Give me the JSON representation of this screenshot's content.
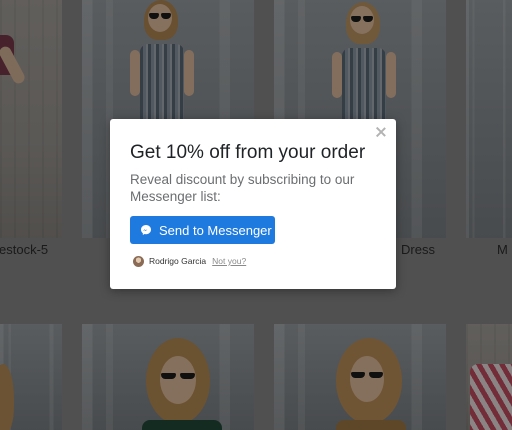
{
  "products": {
    "captions": [
      "estock-5",
      "Dress",
      "M"
    ]
  },
  "modal": {
    "title": "Get 10% off from your order",
    "body": "Reveal discount by subscribing to our Messenger list:",
    "button_label": "Send to Messenger",
    "button_icon": "messenger-icon",
    "close_icon": "close-icon",
    "user_name": "Rodrigo Garcia",
    "not_you_label": "Not you?",
    "accent_color": "#1f7ae0"
  }
}
